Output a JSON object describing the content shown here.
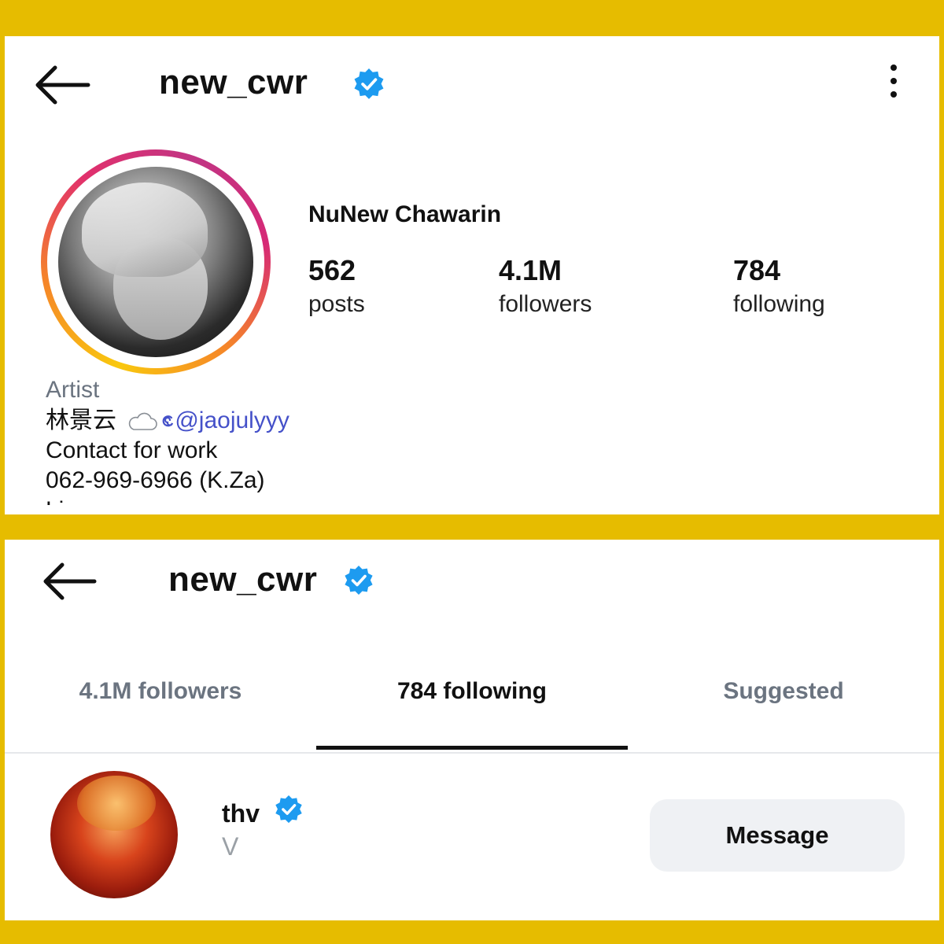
{
  "profile_view": {
    "header": {
      "username": "new_cwr"
    },
    "display_name": "NuNew Chawarin",
    "stats": [
      {
        "value": "562",
        "label": "posts"
      },
      {
        "value": "4.1M",
        "label": "followers"
      },
      {
        "value": "784",
        "label": "following"
      }
    ],
    "bio": {
      "category": "Artist",
      "line1_text": "林景云",
      "line1_mention": "@jaojulyyy",
      "line2": "Contact for work",
      "line3": "062-969-6966 (K.Za)",
      "line4_partial": "Line ... more"
    }
  },
  "following_view": {
    "header": {
      "username": "new_cwr"
    },
    "tabs": [
      {
        "label": "4.1M followers",
        "active": false
      },
      {
        "label": "784 following",
        "active": true
      },
      {
        "label": "Suggested",
        "active": false
      }
    ],
    "list": [
      {
        "username": "thv",
        "full_name": "V",
        "verified": true,
        "action_label": "Message"
      }
    ]
  },
  "colors": {
    "frame": "#E6BC00",
    "verified": "#1D9BF0",
    "mention": "#4551C9",
    "secondary_text": "#6b7480",
    "button_bg": "#EFF1F4"
  },
  "icons": [
    "back-arrow-icon",
    "verified-badge-icon",
    "more-options-icon",
    "cloud-icon",
    "threads-icon"
  ]
}
